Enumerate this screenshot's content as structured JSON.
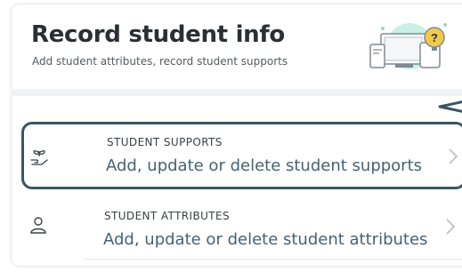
{
  "header": {
    "title": "Record student info",
    "subtitle": "Add student attributes, record student supports"
  },
  "rows": [
    {
      "eyebrow": "STUDENT SUPPORTS",
      "label": "Add, update or delete student supports",
      "icon": "plant-hand-icon",
      "selected": true
    },
    {
      "eyebrow": "STUDENT ATTRIBUTES",
      "label": "Add, update or delete student attributes",
      "icon": "person-icon",
      "selected": false
    }
  ],
  "colors": {
    "title": "#2a2f33",
    "link_text": "#466273",
    "highlight_border": "#3a5562",
    "illustration_accent": "#f2c94c",
    "illustration_mint": "#c9efe6"
  }
}
